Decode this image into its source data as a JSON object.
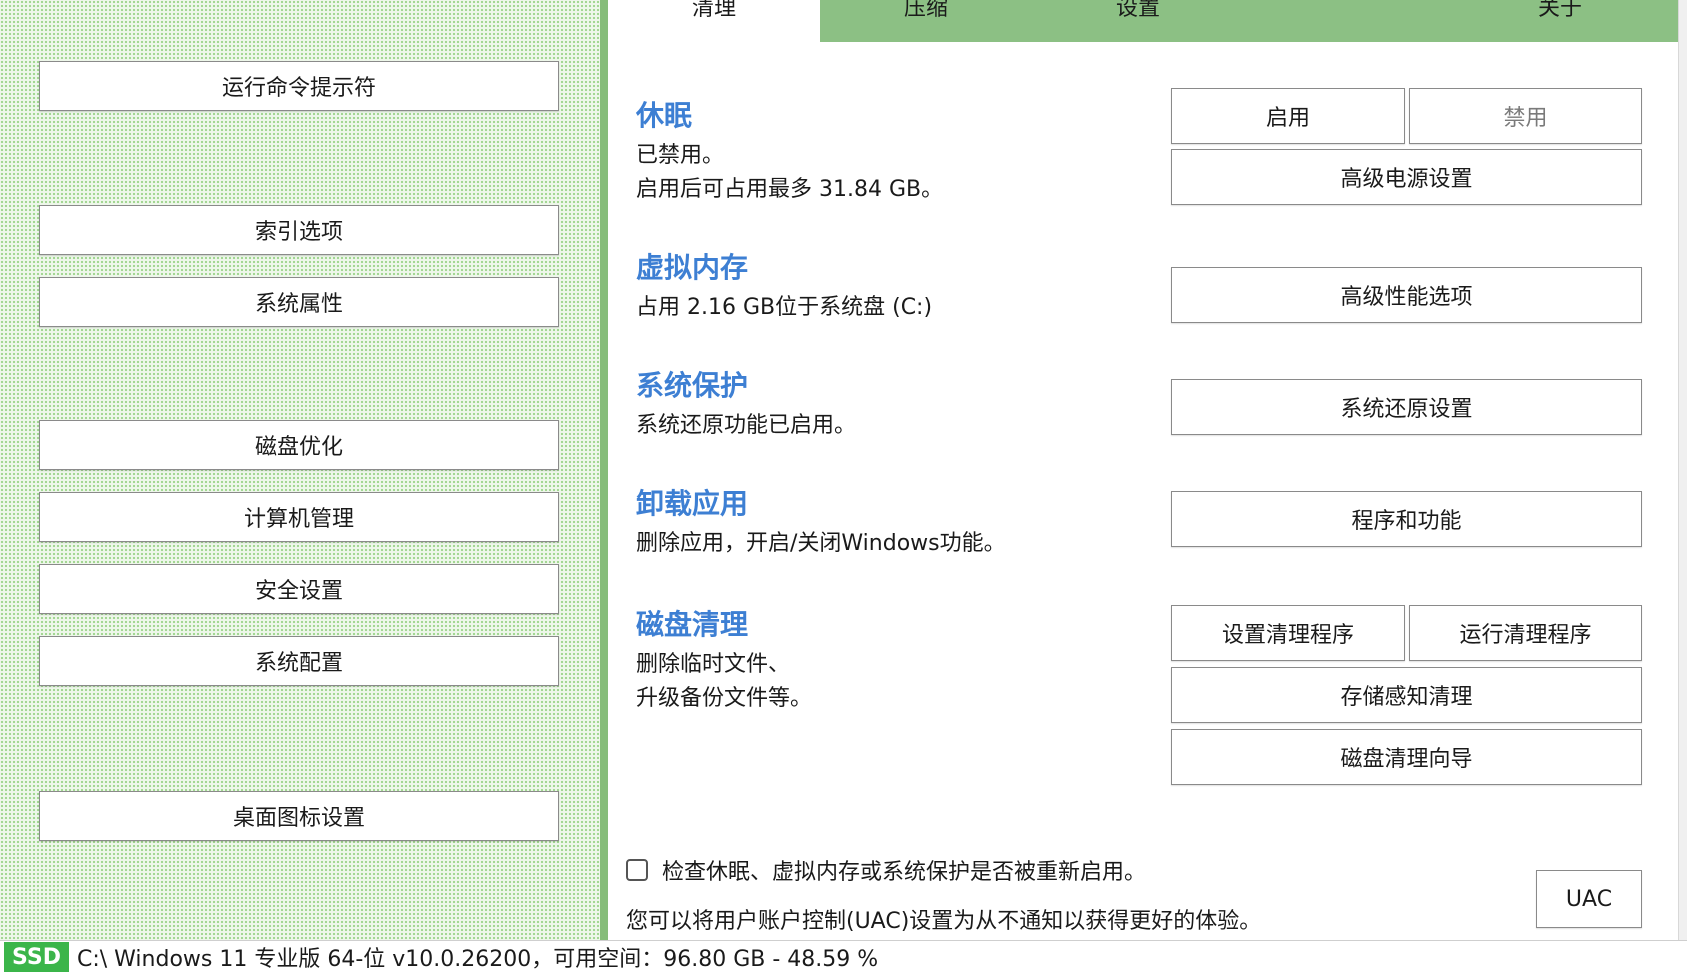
{
  "left": {
    "buttons": [
      "运行命令提示符",
      "索引选项",
      "系统属性",
      "磁盘优化",
      "计算机管理",
      "安全设置",
      "系统配置",
      "桌面图标设置"
    ]
  },
  "tabs": [
    "清理",
    "压缩",
    "设置",
    "关于"
  ],
  "active_tab": "清理",
  "sections": {
    "hibernate": {
      "title": "休眠",
      "desc1": "已禁用。",
      "desc2": "启用后可占用最多 31.84 GB。",
      "enable_label": "启用",
      "disable_label": "禁用",
      "power_label": "高级电源设置"
    },
    "vmem": {
      "title": "虚拟内存",
      "desc": "占用 2.16 GB位于系统盘 (C:)",
      "perf_label": "高级性能选项"
    },
    "protect": {
      "title": "系统保护",
      "desc": "系统还原功能已启用。",
      "restore_label": "系统还原设置"
    },
    "uninstall": {
      "title": "卸载应用",
      "desc": "删除应用，开启/关闭Windows功能。",
      "programs_label": "程序和功能"
    },
    "cleanup": {
      "title": "磁盘清理",
      "desc1": "删除临时文件、",
      "desc2": "升级备份文件等。",
      "setup_label": "设置清理程序",
      "run_label": "运行清理程序",
      "storage_label": "存储感知清理",
      "wizard_label": "磁盘清理向导"
    }
  },
  "footer": {
    "checkbox_label": "检查休眠、虚拟内存或系统保护是否被重新启用。",
    "checkbox_checked": false,
    "uac_text": "您可以将用户账户控制(UAC)设置为从不通知以获得更好的体验。",
    "uac_button": "UAC"
  },
  "status": {
    "badge": "SSD",
    "text": "C:\\ Windows 11 专业版 64-位 v10.0.26200，可用空间：96.80 GB - 48.59 %"
  },
  "colors": {
    "accent": "#3d7fd3",
    "tab_bar": "#8cc084",
    "ssd_badge": "#3bb54a",
    "left_bg": "#eef7ea"
  }
}
